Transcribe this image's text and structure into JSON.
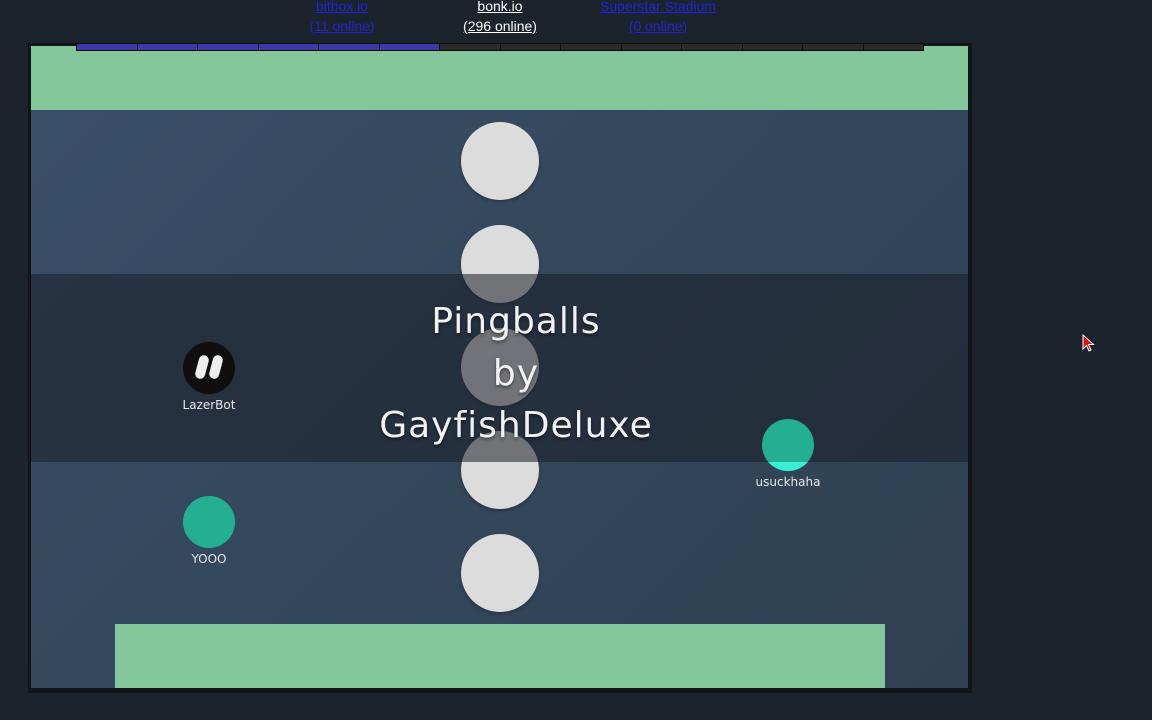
{
  "top_links": [
    {
      "line1": "bitbox.io",
      "line2": "(11 online)",
      "active": false
    },
    {
      "line1": "bonk.io",
      "line2": "(296 online)",
      "active": true
    },
    {
      "line1": "Superstar Stadium",
      "line2": "(0 online)",
      "active": false
    }
  ],
  "round_progress": {
    "segments": 14,
    "filled": 6
  },
  "map_title": {
    "line1": "Pingballs",
    "line2": "by",
    "line3": "GayfishDeluxe"
  },
  "players": [
    {
      "name": "LazerBot",
      "skin": "black-with-eyes"
    },
    {
      "name": "usuckhaha",
      "skin": "teal"
    },
    {
      "name": "YOOO",
      "skin": "teal"
    }
  ],
  "colors": {
    "background": "#1b232c",
    "platform": "#84c79a",
    "peg": "#dcdcdc",
    "player_teal": "#24ae92",
    "progress_fill": "#3d3aa8",
    "link_blue": "#2323d4"
  },
  "icons": {
    "cursor": "red-arrow-cursor-icon"
  }
}
